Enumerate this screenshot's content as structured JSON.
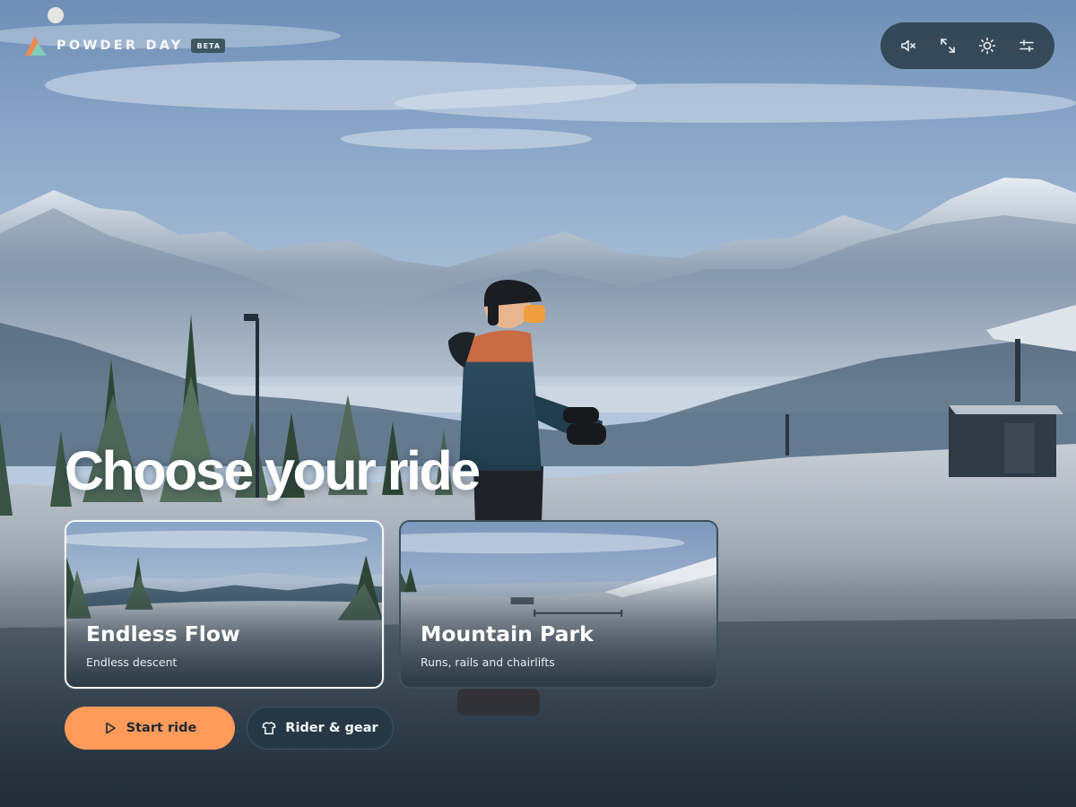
{
  "brand": {
    "name": "POWDER DAY",
    "badge": "BETA",
    "logo_colors": [
      "#f08a4b",
      "#7ad1c1"
    ]
  },
  "controls": [
    {
      "id": "mute",
      "icon": "speaker-muted-icon"
    },
    {
      "id": "fullscreen",
      "icon": "expand-arrows-icon"
    },
    {
      "id": "brightness",
      "icon": "sun-icon"
    },
    {
      "id": "settings",
      "icon": "sliders-icon"
    }
  ],
  "hero": {
    "headline": "Choose your ride"
  },
  "modes": [
    {
      "title": "Endless Flow",
      "subtitle": "Endless descent",
      "selected": true
    },
    {
      "title": "Mountain Park",
      "subtitle": "Runs, rails and chairlifts",
      "selected": false
    }
  ],
  "actions": {
    "start": {
      "label": "Start ride",
      "icon": "play-icon"
    },
    "gear": {
      "label": "Rider & gear",
      "icon": "shirt-icon"
    }
  },
  "colors": {
    "accent": "#ff9a5a",
    "panel": "#2e404c",
    "selected_border": "#f4f6f8",
    "text": "#ffffff"
  }
}
